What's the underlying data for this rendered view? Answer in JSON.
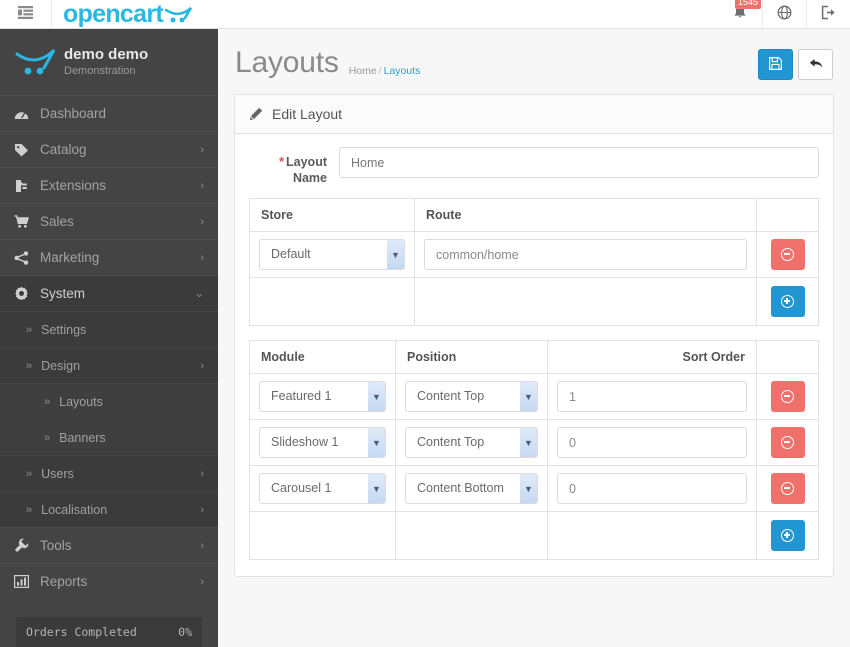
{
  "header": {
    "toggle_icon": "sidebar-toggle-icon",
    "brand": "opencart",
    "brand_cart_icon": "cart-logo-icon",
    "notification_count": "1545",
    "bell_icon": "bell-icon",
    "globe_icon": "globe-icon",
    "logout_icon": "logout-icon"
  },
  "sidebar": {
    "profile": {
      "avatar_icon": "cart-avatar-icon",
      "name": "demo demo",
      "role": "Demonstration"
    },
    "items": [
      {
        "label": "Dashboard",
        "icon": "dashboard-icon",
        "caret": "",
        "level": 0,
        "active": false
      },
      {
        "label": "Catalog",
        "icon": "tag-icon",
        "caret": "›",
        "level": 0,
        "active": false
      },
      {
        "label": "Extensions",
        "icon": "puzzle-icon",
        "caret": "›",
        "level": 0,
        "active": false
      },
      {
        "label": "Sales",
        "icon": "shopping-cart-icon",
        "caret": "›",
        "level": 0,
        "active": false
      },
      {
        "label": "Marketing",
        "icon": "share-icon",
        "caret": "›",
        "level": 0,
        "active": false
      },
      {
        "label": "System",
        "icon": "gear-icon",
        "caret": "⌄",
        "level": 0,
        "active": true
      },
      {
        "label": "Settings",
        "icon": "chevron-double-right-icon",
        "caret": "",
        "level": 1,
        "active": false
      },
      {
        "label": "Design",
        "icon": "chevron-double-right-icon",
        "caret": "›",
        "level": 1,
        "active": false
      },
      {
        "label": "Layouts",
        "icon": "chevron-double-right-icon",
        "caret": "",
        "level": 2,
        "active": false
      },
      {
        "label": "Banners",
        "icon": "chevron-double-right-icon",
        "caret": "",
        "level": 2,
        "active": false
      },
      {
        "label": "Users",
        "icon": "chevron-double-right-icon",
        "caret": "›",
        "level": 1,
        "active": false
      },
      {
        "label": "Localisation",
        "icon": "chevron-double-right-icon",
        "caret": "›",
        "level": 1,
        "active": false
      },
      {
        "label": "Tools",
        "icon": "wrench-icon",
        "caret": "›",
        "level": 0,
        "active": false
      },
      {
        "label": "Reports",
        "icon": "bar-chart-icon",
        "caret": "›",
        "level": 0,
        "active": false
      }
    ],
    "footer": {
      "progress_label": "Orders Completed",
      "progress_value": "0%"
    }
  },
  "page": {
    "title": "Layouts",
    "breadcrumb": [
      {
        "label": "Home",
        "current": false
      },
      {
        "label": "Layouts",
        "current": true
      }
    ],
    "breadcrumb_separator": "/",
    "actions": {
      "save_label": "save-button",
      "save_icon": "floppy-save-icon",
      "back_label": "back-button",
      "back_icon": "back-arrow-icon"
    }
  },
  "panel": {
    "title": "Edit Layout",
    "title_icon": "pencil-icon",
    "layout_name": {
      "label": "Layout Name",
      "required_mark": "*",
      "value": "Home",
      "placeholder": "Layout Name"
    },
    "route_table": {
      "headers": [
        "Store",
        "Route",
        ""
      ],
      "rows": [
        {
          "store": "Default",
          "route": "common/home",
          "remove_icon": "minus-circle-icon"
        }
      ],
      "add_icon": "plus-circle-icon"
    },
    "module_table": {
      "headers": [
        "Module",
        "Position",
        "Sort Order",
        ""
      ],
      "rows": [
        {
          "module": "Featured 1",
          "position": "Content Top",
          "sort_order": "1",
          "remove_icon": "minus-circle-icon"
        },
        {
          "module": "Slideshow 1",
          "position": "Content Top",
          "sort_order": "0",
          "remove_icon": "minus-circle-icon"
        },
        {
          "module": "Carousel 1",
          "position": "Content Bottom",
          "sort_order": "0",
          "remove_icon": "minus-circle-icon"
        }
      ],
      "add_icon": "plus-circle-icon"
    }
  },
  "colors": {
    "brand": "#29b8e5",
    "primary": "#2196d3",
    "danger": "#f0706b",
    "sidebar": "#444444",
    "link": "#23a1d1"
  }
}
